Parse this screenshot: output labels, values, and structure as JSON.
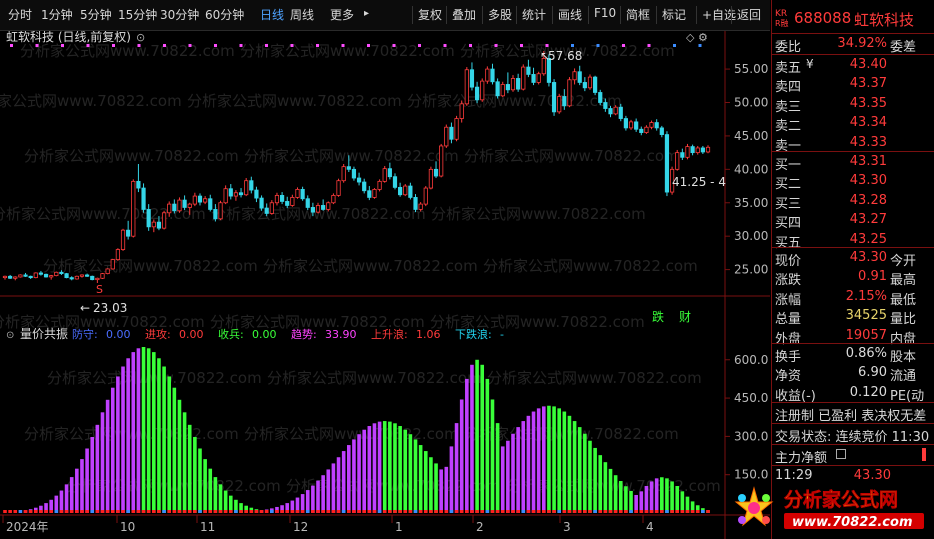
{
  "toolbar": {
    "periods": [
      "分时",
      "1分钟",
      "5分钟",
      "15分钟",
      "30分钟",
      "60分钟",
      "日线",
      "周线",
      "更多"
    ],
    "active_period": "日线",
    "more_arrow": "▸",
    "actions": [
      "复权",
      "叠加",
      "多股",
      "统计",
      "画线",
      "F10",
      "简框",
      "标记",
      "+自选",
      "返回"
    ]
  },
  "main_chart": {
    "title": "虹软科技 (日线,前复权)",
    "high_label": "57.68",
    "low_label": "23.03",
    "recent_label": "41.25 - 4",
    "marker_die": "跌",
    "marker_cai": "财",
    "marker_s": "S",
    "y_ticks": [
      "55.00",
      "50.00",
      "45.00",
      "40.00",
      "35.00",
      "30.00",
      "25.00"
    ]
  },
  "indicator": {
    "name": "量价共振",
    "items": [
      {
        "label": "防守:",
        "value": "0.00",
        "color": "#4a6cff"
      },
      {
        "label": "进攻:",
        "value": "0.00",
        "color": "#ff3b3b"
      },
      {
        "label": "收兵:",
        "value": "0.00",
        "color": "#39ff39"
      },
      {
        "label": "趋势:",
        "value": "33.90",
        "color": "#ff44ff"
      },
      {
        "label": "上升浪:",
        "value": "1.06",
        "color": "#ff3b3b"
      },
      {
        "label": "下跌浪:",
        "value": "-",
        "color": "#22d3ee"
      }
    ],
    "y_ticks": [
      "600.0",
      "450.0",
      "300.0",
      "150.0"
    ]
  },
  "x_axis": [
    "2024年",
    "10",
    "11",
    "12",
    "1",
    "2",
    "3",
    "4"
  ],
  "watermark": "分析家公式网www.70822.com",
  "stock": {
    "code": "688088",
    "name": "虹软科技",
    "badge_top": "KR",
    "badge_bot": "R融"
  },
  "quote": {
    "weibi_label": "委比",
    "weibi": "34.92%",
    "weicha_label": "委差",
    "asks": [
      {
        "l": "卖五",
        "v": "43.40",
        "x": "¥"
      },
      {
        "l": "卖四",
        "v": "43.37"
      },
      {
        "l": "卖三",
        "v": "43.35"
      },
      {
        "l": "卖二",
        "v": "43.34"
      },
      {
        "l": "卖一",
        "v": "43.33"
      }
    ],
    "bids": [
      {
        "l": "买一",
        "v": "43.31"
      },
      {
        "l": "买二",
        "v": "43.30"
      },
      {
        "l": "买三",
        "v": "43.28"
      },
      {
        "l": "买四",
        "v": "43.27"
      },
      {
        "l": "买五",
        "v": "43.25"
      }
    ],
    "stats": [
      {
        "l": "现价",
        "v": "43.30",
        "c": "red",
        "r": "今开"
      },
      {
        "l": "涨跌",
        "v": "0.91",
        "c": "red",
        "r": "最高"
      },
      {
        "l": "涨幅",
        "v": "2.15%",
        "c": "red",
        "r": "最低"
      },
      {
        "l": "总量",
        "v": "34525",
        "c": "yel",
        "r": "量比"
      },
      {
        "l": "外盘",
        "v": "19057",
        "c": "red",
        "r": "内盘"
      }
    ],
    "stats2": [
      {
        "l": "换手",
        "v": "0.86%",
        "r": "股本"
      },
      {
        "l": "净资",
        "v": "6.90",
        "r": "流通"
      },
      {
        "l": "收益(-)",
        "v": "0.120",
        "r": "PE(动"
      }
    ],
    "reg_line": "注册制 已盈利 表决权无差",
    "trade_state": "交易状态: 连续竞价 11:30",
    "main_flow_label": "主力净额",
    "last_time": "11:29",
    "last_price": "43.30"
  },
  "logo": {
    "text": "分析家公式网",
    "url": "www.70822.com"
  },
  "candles": [
    [
      23.8,
      24.1,
      23.5,
      24.0
    ],
    [
      24.0,
      24.2,
      23.6,
      23.7
    ],
    [
      23.7,
      24.0,
      23.4,
      23.9
    ],
    [
      23.9,
      24.3,
      23.8,
      24.2
    ],
    [
      24.2,
      24.5,
      23.9,
      24.0
    ],
    [
      24.0,
      24.1,
      23.6,
      23.8
    ],
    [
      23.8,
      24.6,
      23.7,
      24.5
    ],
    [
      24.5,
      24.8,
      24.1,
      24.3
    ],
    [
      24.3,
      24.4,
      23.8,
      23.9
    ],
    [
      23.9,
      24.2,
      23.5,
      24.1
    ],
    [
      24.1,
      24.7,
      24.0,
      24.6
    ],
    [
      24.6,
      24.9,
      24.2,
      24.4
    ],
    [
      24.4,
      24.5,
      23.7,
      23.8
    ],
    [
      23.8,
      24.0,
      23.4,
      23.6
    ],
    [
      23.6,
      24.1,
      23.5,
      24.0
    ],
    [
      24.0,
      24.3,
      23.8,
      24.2
    ],
    [
      24.2,
      24.4,
      23.9,
      24.0
    ],
    [
      24.0,
      24.1,
      23.4,
      23.5
    ],
    [
      23.5,
      23.8,
      23.0,
      23.7
    ],
    [
      23.7,
      24.5,
      23.6,
      24.4
    ],
    [
      24.4,
      25.2,
      24.3,
      25.1
    ],
    [
      25.1,
      26.6,
      25.0,
      26.5
    ],
    [
      26.5,
      28.2,
      26.3,
      28.0
    ],
    [
      28.0,
      31.1,
      27.8,
      30.9
    ],
    [
      30.9,
      32.3,
      29.5,
      30.0
    ],
    [
      30.0,
      38.5,
      29.8,
      38.2
    ],
    [
      38.2,
      40.8,
      36.6,
      37.2
    ],
    [
      37.2,
      37.9,
      33.5,
      34.0
    ],
    [
      34.0,
      34.8,
      30.8,
      31.4
    ],
    [
      31.4,
      32.5,
      30.6,
      32.1
    ],
    [
      32.1,
      33.0,
      30.9,
      31.2
    ],
    [
      31.2,
      33.8,
      31.0,
      33.5
    ],
    [
      33.5,
      35.2,
      32.9,
      34.8
    ],
    [
      34.8,
      35.5,
      33.4,
      33.8
    ],
    [
      33.8,
      35.8,
      33.5,
      35.4
    ],
    [
      35.4,
      36.1,
      33.9,
      34.3
    ],
    [
      34.3,
      35.0,
      33.2,
      34.8
    ],
    [
      34.8,
      36.5,
      34.5,
      36.0
    ],
    [
      36.0,
      36.4,
      34.6,
      35.1
    ],
    [
      35.1,
      36.0,
      34.8,
      35.6
    ],
    [
      35.6,
      36.2,
      33.7,
      34.0
    ],
    [
      34.0,
      34.8,
      32.2,
      32.6
    ],
    [
      32.6,
      35.3,
      32.4,
      35.0
    ],
    [
      35.0,
      37.6,
      34.8,
      37.1
    ],
    [
      37.1,
      37.8,
      35.5,
      36.0
    ],
    [
      36.0,
      36.9,
      35.3,
      36.5
    ],
    [
      36.5,
      37.2,
      35.8,
      36.2
    ],
    [
      36.2,
      38.7,
      36.0,
      38.3
    ],
    [
      38.3,
      38.9,
      36.4,
      36.9
    ],
    [
      36.9,
      37.4,
      35.1,
      35.7
    ],
    [
      35.7,
      36.1,
      33.8,
      34.2
    ],
    [
      34.2,
      34.9,
      33.0,
      33.4
    ],
    [
      33.4,
      35.4,
      33.2,
      35.0
    ],
    [
      35.0,
      36.5,
      34.6,
      36.1
    ],
    [
      36.1,
      36.6,
      34.8,
      35.2
    ],
    [
      35.2,
      35.9,
      34.2,
      34.6
    ],
    [
      34.6,
      36.2,
      34.4,
      35.8
    ],
    [
      35.8,
      37.3,
      35.6,
      37.0
    ],
    [
      37.0,
      37.4,
      35.3,
      35.6
    ],
    [
      35.6,
      36.1,
      33.9,
      34.3
    ],
    [
      34.3,
      35.0,
      33.0,
      33.6
    ],
    [
      33.6,
      35.0,
      33.4,
      34.6
    ],
    [
      34.6,
      35.5,
      33.8,
      34.0
    ],
    [
      34.0,
      35.2,
      33.7,
      35.0
    ],
    [
      35.0,
      36.4,
      34.8,
      36.1
    ],
    [
      36.1,
      38.6,
      35.9,
      38.3
    ],
    [
      38.3,
      40.8,
      38.0,
      40.4
    ],
    [
      40.4,
      42.1,
      39.6,
      40.0
    ],
    [
      40.0,
      40.4,
      38.3,
      38.7
    ],
    [
      38.7,
      39.5,
      37.6,
      38.1
    ],
    [
      38.1,
      38.6,
      36.4,
      36.8
    ],
    [
      36.8,
      37.5,
      35.4,
      35.8
    ],
    [
      35.8,
      37.2,
      35.6,
      37.0
    ],
    [
      37.0,
      38.5,
      36.7,
      38.2
    ],
    [
      38.2,
      40.5,
      38.0,
      40.1
    ],
    [
      40.1,
      41.0,
      38.5,
      38.9
    ],
    [
      38.9,
      39.4,
      37.0,
      37.3
    ],
    [
      37.3,
      38.0,
      35.9,
      36.2
    ],
    [
      36.2,
      37.8,
      36.0,
      37.5
    ],
    [
      37.5,
      38.0,
      35.5,
      35.8
    ],
    [
      35.8,
      36.3,
      33.6,
      34.0
    ],
    [
      34.0,
      35.1,
      33.7,
      34.8
    ],
    [
      34.8,
      37.5,
      34.5,
      37.2
    ],
    [
      37.2,
      40.4,
      37.0,
      40.0
    ],
    [
      40.0,
      41.2,
      38.7,
      39.0
    ],
    [
      39.0,
      43.8,
      38.8,
      43.5
    ],
    [
      43.5,
      46.7,
      43.2,
      46.3
    ],
    [
      46.3,
      47.0,
      43.9,
      44.5
    ],
    [
      44.5,
      48.0,
      44.2,
      47.6
    ],
    [
      47.6,
      50.3,
      47.0,
      49.8
    ],
    [
      49.8,
      55.3,
      49.5,
      54.9
    ],
    [
      54.9,
      56.0,
      51.8,
      52.3
    ],
    [
      52.3,
      53.1,
      49.9,
      50.4
    ],
    [
      50.4,
      53.6,
      50.1,
      53.2
    ],
    [
      53.2,
      55.4,
      52.8,
      55.0
    ],
    [
      55.0,
      55.8,
      52.7,
      53.1
    ],
    [
      53.1,
      53.6,
      50.6,
      51.0
    ],
    [
      51.0,
      53.1,
      50.8,
      52.7
    ],
    [
      52.7,
      54.5,
      51.4,
      51.9
    ],
    [
      51.9,
      54.1,
      51.6,
      53.6
    ],
    [
      53.6,
      54.3,
      51.6,
      52.0
    ],
    [
      52.0,
      55.7,
      51.8,
      55.3
    ],
    [
      55.3,
      56.4,
      53.8,
      54.2
    ],
    [
      54.2,
      55.2,
      52.6,
      53.0
    ],
    [
      53.0,
      54.6,
      52.7,
      54.3
    ],
    [
      54.3,
      57.7,
      54.0,
      56.6
    ],
    [
      56.6,
      57.2,
      52.4,
      53.0
    ],
    [
      53.0,
      53.5,
      48.0,
      48.6
    ],
    [
      48.6,
      51.3,
      48.3,
      50.9
    ],
    [
      50.9,
      52.0,
      48.9,
      49.5
    ],
    [
      49.5,
      53.8,
      49.3,
      53.4
    ],
    [
      53.4,
      55.1,
      52.7,
      54.6
    ],
    [
      54.6,
      55.5,
      52.6,
      53.0
    ],
    [
      53.0,
      53.8,
      51.7,
      52.2
    ],
    [
      52.2,
      54.2,
      51.9,
      53.8
    ],
    [
      53.8,
      54.0,
      51.1,
      51.5
    ],
    [
      51.5,
      51.9,
      49.6,
      50.0
    ],
    [
      50.0,
      50.6,
      48.6,
      49.1
    ],
    [
      49.1,
      49.5,
      47.8,
      48.3
    ],
    [
      48.3,
      49.6,
      48.1,
      49.3
    ],
    [
      49.3,
      49.8,
      47.2,
      47.6
    ],
    [
      47.6,
      48.0,
      45.8,
      46.2
    ],
    [
      46.2,
      47.4,
      45.9,
      47.1
    ],
    [
      47.1,
      47.6,
      45.6,
      46.0
    ],
    [
      46.0,
      46.4,
      45.1,
      45.5
    ],
    [
      45.5,
      46.6,
      45.3,
      46.3
    ],
    [
      46.3,
      47.3,
      46.0,
      47.0
    ],
    [
      47.0,
      47.5,
      45.8,
      46.2
    ],
    [
      46.2,
      46.5,
      44.8,
      45.2
    ],
    [
      45.2,
      45.7,
      36.0,
      36.6
    ],
    [
      36.6,
      40.4,
      36.2,
      40.0
    ],
    [
      40.0,
      42.9,
      39.8,
      42.5
    ],
    [
      42.5,
      43.1,
      41.4,
      41.8
    ],
    [
      41.8,
      43.8,
      41.5,
      43.4
    ],
    [
      43.4,
      43.7,
      42.1,
      42.5
    ],
    [
      42.5,
      43.5,
      42.2,
      43.2
    ],
    [
      43.2,
      43.5,
      42.3,
      42.6
    ],
    [
      42.6,
      43.6,
      42.4,
      43.3
    ]
  ]
}
